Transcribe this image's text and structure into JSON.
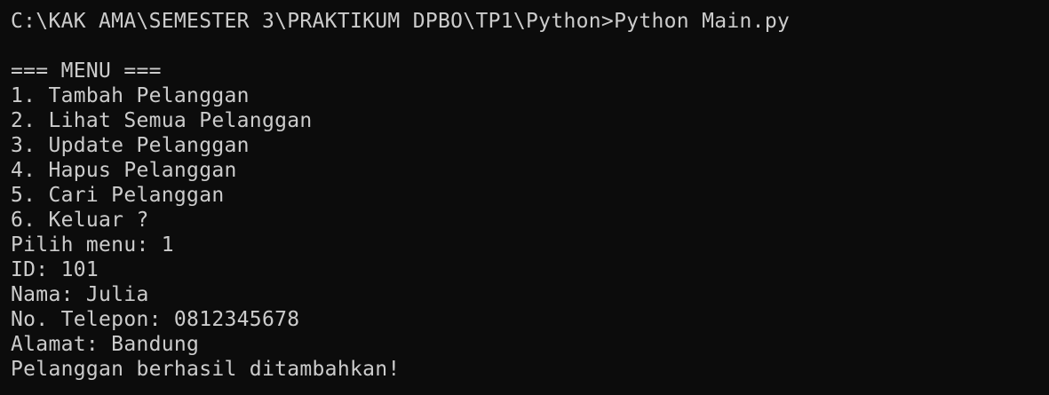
{
  "terminal": {
    "prompt_line": "C:\\KAK AMA\\SEMESTER 3\\PRAKTIKUM DPBO\\TP1\\Python>Python Main.py",
    "menu_title": "=== MENU ===",
    "menu_items": [
      "1. Tambah Pelanggan",
      "2. Lihat Semua Pelanggan",
      "3. Update Pelanggan",
      "4. Hapus Pelanggan",
      "5. Cari Pelanggan",
      "6. Keluar ?"
    ],
    "inputs": [
      "Pilih menu: 1",
      "ID: 101",
      "Nama: Julia",
      "No. Telepon: 0812345678",
      "Alamat: Bandung"
    ],
    "result": "Pelanggan berhasil ditambahkan!",
    "colors": {
      "background": "#0c0c0c",
      "text": "#cccccc"
    }
  }
}
